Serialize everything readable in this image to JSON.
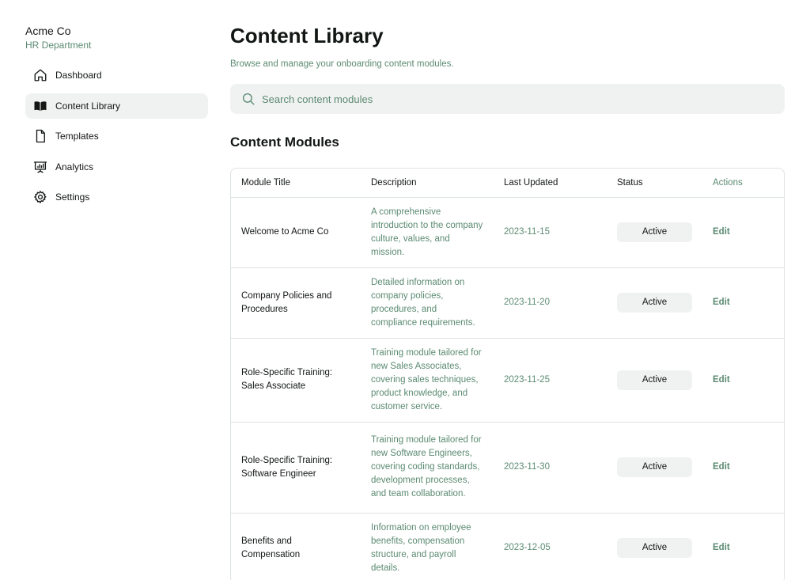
{
  "brand": {
    "name": "Acme Co",
    "department": "HR Department"
  },
  "sidebar": {
    "items": [
      {
        "label": "Dashboard",
        "icon": "home-icon"
      },
      {
        "label": "Content Library",
        "icon": "book-icon",
        "active": true
      },
      {
        "label": "Templates",
        "icon": "file-icon"
      },
      {
        "label": "Analytics",
        "icon": "presentation-chart-icon"
      },
      {
        "label": "Settings",
        "icon": "gear-icon"
      }
    ]
  },
  "main": {
    "title": "Content Library",
    "subtitle": "Browse and manage your onboarding content modules.",
    "search": {
      "placeholder": "Search content modules",
      "value": ""
    },
    "section_title": "Content Modules",
    "table": {
      "headers": [
        "Module Title",
        "Description",
        "Last Updated",
        "Status",
        "Actions"
      ],
      "rows": [
        {
          "title": "Welcome to Acme Co",
          "description": "A comprehensive introduction to the company culture, values, and mission.",
          "updated": "2023-11-15",
          "status": "Active",
          "action": "Edit"
        },
        {
          "title": "Company Policies and Procedures",
          "description": "Detailed information on company policies, procedures, and compliance requirements.",
          "updated": "2023-11-20",
          "status": "Active",
          "action": "Edit"
        },
        {
          "title": "Role-Specific Training: Sales Associate",
          "description": "Training module tailored for new Sales Associates, covering sales techniques, product knowledge, and customer service.",
          "updated": "2023-11-25",
          "status": "Active",
          "action": "Edit"
        },
        {
          "title": "Role-Specific Training: Software Engineer",
          "description": "Training module tailored for new Software Engineers, covering coding standards, development processes, and team collaboration.",
          "updated": "2023-11-30",
          "status": "Active",
          "action": "Edit"
        },
        {
          "title": "Benefits and Compensation",
          "description": "Information on employee benefits, compensation structure, and payroll details.",
          "updated": "2023-12-05",
          "status": "Active",
          "action": "Edit"
        }
      ]
    }
  },
  "colors": {
    "accent": "#5b8a72",
    "text": "#121714",
    "surface": "#f0f2f1",
    "border": "#dde3e0"
  }
}
